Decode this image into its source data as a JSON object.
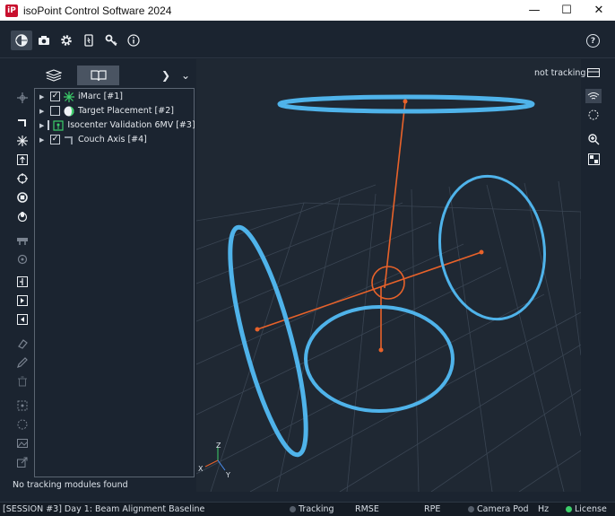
{
  "window": {
    "title": "isoPoint Control Software 2024",
    "logo_text": "iP",
    "minimize": "—",
    "maximize": "☐",
    "close": "✕"
  },
  "toolbar": {
    "icons": [
      "globe-icon",
      "camera-icon",
      "gear-icon",
      "tablet-icon",
      "key-icon",
      "info-icon"
    ],
    "help_label": "?"
  },
  "panel": {
    "tabs": [
      "layers-icon",
      "book-icon"
    ],
    "next_label": "❯",
    "menu_label": "⌄",
    "tree": [
      {
        "label": "iMarc [#1]",
        "checked": true,
        "icon": "asterisk-icon"
      },
      {
        "label": "Target Placement [#2]",
        "checked": false,
        "icon": "target-placement-icon"
      },
      {
        "label": "Isocenter Validation 6MV [#3]",
        "checked": false,
        "icon": "isocenter-icon"
      },
      {
        "label": "Couch Axis [#4]",
        "checked": true,
        "icon": "couch-axis-icon"
      }
    ],
    "check_mark": "✓",
    "expander": "▶"
  },
  "tracking_status": "not tracking",
  "no_modules": "No tracking modules found",
  "axes": {
    "x": "X",
    "y": "Y",
    "z": "Z"
  },
  "status_bar": {
    "session": "[SESSION #3] Day 1: Beam Alignment Baseline",
    "tracking": "Tracking",
    "rmse": "RMSE",
    "rpe": "RPE",
    "camera_pod": "Camera Pod",
    "hz": "Hz",
    "license": "License"
  },
  "colors": {
    "background": "#1b2430",
    "ring": "#4fb3ea",
    "axis": "#e8622a",
    "license_dot": "#3ccf6a",
    "inactive_dot": "#555e6a"
  }
}
